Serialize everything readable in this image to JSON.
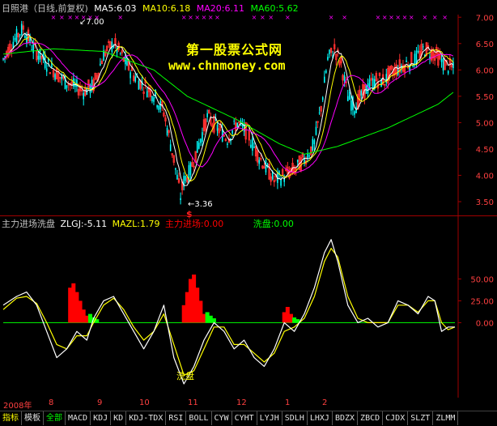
{
  "header": {
    "title": "日照港（日线,前复权)",
    "ma5": "MA5:6.03",
    "ma10": "MA10:6.18",
    "ma20": "MA20:6.11",
    "ma60": "MA60:5.62"
  },
  "watermark": {
    "line1": "第一股票公式网",
    "line2": "www.chnmoney.com"
  },
  "annotations": {
    "high": "7.00",
    "low": "3.36",
    "dollar": "$",
    "xipan_word": "洗盘"
  },
  "sub_header": {
    "title": "主力进场洗盘",
    "zlgj": "ZLGJ:-5.11",
    "mazl": "MAZL:1.79",
    "zljc": "主力进场:0.00",
    "xipan": "洗盘:0.00"
  },
  "colors": {
    "ma5": "#ffffff",
    "ma10": "#ffff00",
    "ma20": "#ff00ff",
    "ma60": "#00ff00",
    "up": "#ff3030",
    "down": "#00ffff",
    "zlgj": "#ffffff",
    "mazl": "#ffff00",
    "zljc": "#ff0000",
    "xipan": "#00ff00",
    "zero": "#00ff00"
  },
  "date_bar": {
    "year": "2008年",
    "months": [
      "8",
      "9",
      "10",
      "11",
      "12",
      "1",
      "2"
    ]
  },
  "tabs": [
    "指标",
    "模板",
    "全部",
    "MACD",
    "KDJ",
    "KD",
    "KDJ-TDX",
    "RSI",
    "BOLL",
    "CYW",
    "CYHT",
    "LYJH",
    "SDLH",
    "LHXJ",
    "BDZX",
    "ZBCD",
    "CJDX",
    "SLZT",
    "ZLMM"
  ],
  "chart_data": [
    {
      "type": "candlestick",
      "title": "日照港（日线,前复权)",
      "ylim": [
        3.3,
        7.05
      ],
      "yticks": [
        "7.00",
        "6.50",
        "6.00",
        "5.50",
        "5.00",
        "4.50",
        "4.00",
        "3.50"
      ],
      "ma_legend": [
        "MA5",
        "MA10",
        "MA20",
        "MA60"
      ],
      "price_path": [
        [
          0,
          6.2
        ],
        [
          6,
          6.55
        ],
        [
          12,
          6.8
        ],
        [
          18,
          6.4
        ],
        [
          24,
          6.2
        ],
        [
          30,
          6.0
        ],
        [
          36,
          5.8
        ],
        [
          42,
          5.7
        ],
        [
          48,
          5.6
        ],
        [
          54,
          5.7
        ],
        [
          60,
          6.3
        ],
        [
          66,
          6.5
        ],
        [
          72,
          6.2
        ],
        [
          78,
          5.9
        ],
        [
          84,
          5.7
        ],
        [
          90,
          5.55
        ],
        [
          96,
          5.2
        ],
        [
          102,
          4.3
        ],
        [
          106,
          3.6
        ],
        [
          108,
          3.9
        ],
        [
          112,
          4.1
        ],
        [
          116,
          4.5
        ],
        [
          122,
          5.1
        ],
        [
          128,
          4.9
        ],
        [
          134,
          4.7
        ],
        [
          140,
          5.0
        ],
        [
          146,
          4.8
        ],
        [
          152,
          4.4
        ],
        [
          158,
          4.1
        ],
        [
          162,
          3.9
        ],
        [
          168,
          4.0
        ],
        [
          174,
          4.1
        ],
        [
          180,
          4.3
        ],
        [
          186,
          4.6
        ],
        [
          190,
          5.3
        ],
        [
          194,
          6.2
        ],
        [
          198,
          6.4
        ],
        [
          202,
          6.1
        ],
        [
          206,
          5.5
        ],
        [
          210,
          5.3
        ],
        [
          216,
          5.6
        ],
        [
          222,
          5.8
        ],
        [
          228,
          5.8
        ],
        [
          234,
          6.0
        ],
        [
          240,
          6.1
        ],
        [
          246,
          6.2
        ],
        [
          252,
          6.4
        ],
        [
          258,
          6.3
        ],
        [
          264,
          6.1
        ],
        [
          270,
          6.0
        ]
      ],
      "ma60_path": [
        [
          0,
          6.3
        ],
        [
          30,
          6.4
        ],
        [
          60,
          6.35
        ],
        [
          90,
          6.0
        ],
        [
          110,
          5.5
        ],
        [
          140,
          5.05
        ],
        [
          165,
          4.6
        ],
        [
          180,
          4.4
        ],
        [
          200,
          4.55
        ],
        [
          230,
          4.9
        ],
        [
          260,
          5.35
        ],
        [
          270,
          5.6
        ]
      ]
    },
    {
      "type": "line",
      "title": "主力进场洗盘",
      "ylim": [
        -82,
        105
      ],
      "yticks": [
        "50.00",
        "25.00",
        "0.00"
      ],
      "series": [
        {
          "name": "ZLGJ",
          "values": [
            [
              0,
              20
            ],
            [
              8,
              30
            ],
            [
              14,
              35
            ],
            [
              20,
              20
            ],
            [
              26,
              -10
            ],
            [
              32,
              -40
            ],
            [
              38,
              -30
            ],
            [
              44,
              -10
            ],
            [
              50,
              -20
            ],
            [
              54,
              5
            ],
            [
              60,
              25
            ],
            [
              66,
              30
            ],
            [
              72,
              10
            ],
            [
              78,
              -10
            ],
            [
              84,
              -30
            ],
            [
              90,
              -10
            ],
            [
              96,
              20
            ],
            [
              102,
              -40
            ],
            [
              108,
              -70
            ],
            [
              114,
              -50
            ],
            [
              120,
              -20
            ],
            [
              126,
              0
            ],
            [
              132,
              -10
            ],
            [
              138,
              -30
            ],
            [
              144,
              -20
            ],
            [
              150,
              -40
            ],
            [
              156,
              -50
            ],
            [
              162,
              -30
            ],
            [
              168,
              0
            ],
            [
              174,
              -10
            ],
            [
              180,
              10
            ],
            [
              186,
              40
            ],
            [
              192,
              80
            ],
            [
              196,
              95
            ],
            [
              200,
              70
            ],
            [
              206,
              20
            ],
            [
              212,
              0
            ],
            [
              218,
              5
            ],
            [
              224,
              -5
            ],
            [
              230,
              0
            ],
            [
              236,
              25
            ],
            [
              242,
              20
            ],
            [
              248,
              10
            ],
            [
              254,
              30
            ],
            [
              258,
              25
            ],
            [
              262,
              -10
            ],
            [
              266,
              -5
            ],
            [
              270,
              -5
            ]
          ]
        },
        {
          "name": "MAZL",
          "values": [
            [
              0,
              15
            ],
            [
              8,
              28
            ],
            [
              14,
              30
            ],
            [
              20,
              22
            ],
            [
              26,
              0
            ],
            [
              32,
              -25
            ],
            [
              38,
              -30
            ],
            [
              44,
              -15
            ],
            [
              50,
              -15
            ],
            [
              54,
              0
            ],
            [
              60,
              20
            ],
            [
              66,
              28
            ],
            [
              72,
              15
            ],
            [
              78,
              -5
            ],
            [
              84,
              -20
            ],
            [
              90,
              -10
            ],
            [
              96,
              10
            ],
            [
              102,
              -25
            ],
            [
              108,
              -60
            ],
            [
              114,
              -55
            ],
            [
              120,
              -30
            ],
            [
              126,
              -5
            ],
            [
              132,
              -5
            ],
            [
              138,
              -25
            ],
            [
              144,
              -25
            ],
            [
              150,
              -35
            ],
            [
              156,
              -45
            ],
            [
              162,
              -35
            ],
            [
              168,
              -10
            ],
            [
              174,
              -5
            ],
            [
              180,
              5
            ],
            [
              186,
              30
            ],
            [
              192,
              70
            ],
            [
              196,
              85
            ],
            [
              200,
              75
            ],
            [
              206,
              30
            ],
            [
              212,
              5
            ],
            [
              218,
              0
            ],
            [
              224,
              0
            ],
            [
              230,
              0
            ],
            [
              236,
              20
            ],
            [
              242,
              20
            ],
            [
              248,
              12
            ],
            [
              254,
              25
            ],
            [
              258,
              25
            ],
            [
              262,
              0
            ],
            [
              266,
              -8
            ],
            [
              270,
              -5
            ]
          ]
        }
      ],
      "zljc_bars": [
        [
          40,
          40
        ],
        [
          42,
          45
        ],
        [
          44,
          35
        ],
        [
          46,
          25
        ],
        [
          48,
          15
        ],
        [
          50,
          8
        ],
        [
          108,
          20
        ],
        [
          110,
          35
        ],
        [
          112,
          50
        ],
        [
          114,
          55
        ],
        [
          116,
          40
        ],
        [
          118,
          25
        ],
        [
          120,
          10
        ],
        [
          168,
          12
        ],
        [
          170,
          18
        ],
        [
          172,
          10
        ]
      ],
      "xipan_bars": [
        [
          52,
          10
        ],
        [
          54,
          6
        ],
        [
          56,
          4
        ],
        [
          122,
          12
        ],
        [
          124,
          8
        ],
        [
          126,
          5
        ],
        [
          174,
          6
        ],
        [
          176,
          4
        ]
      ]
    }
  ]
}
